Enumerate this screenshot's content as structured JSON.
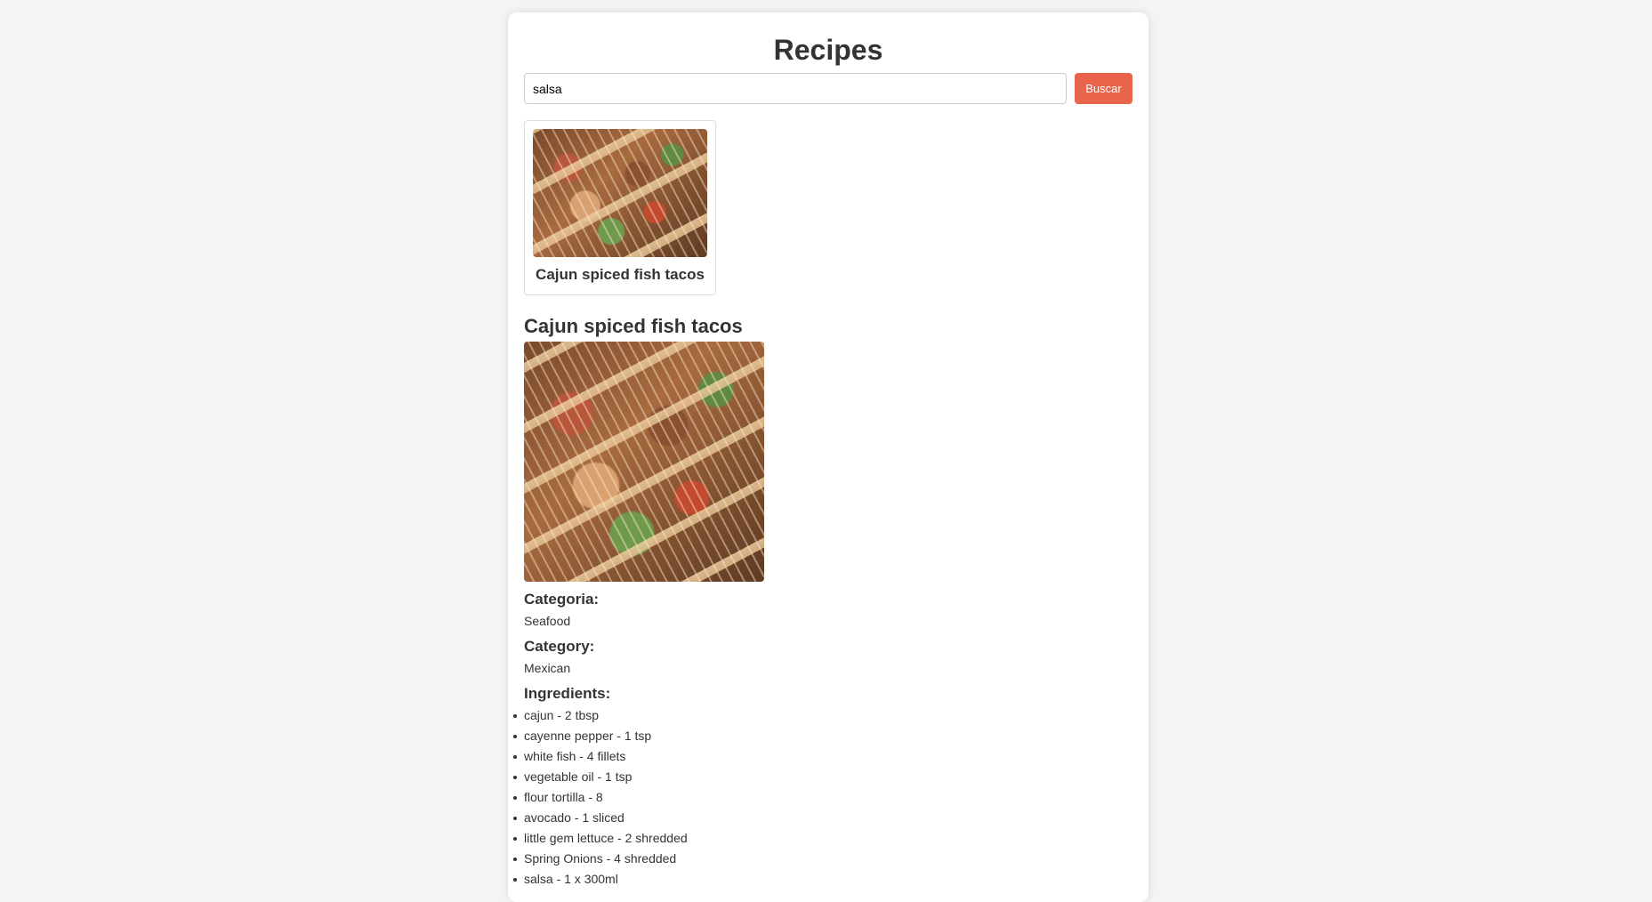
{
  "app": {
    "title": "Recipes"
  },
  "search": {
    "value": "salsa",
    "button_label": "Buscar"
  },
  "results": [
    {
      "name": "Cajun spiced fish tacos",
      "image": "fish-tacos-photo"
    }
  ],
  "detail": {
    "title": "Cajun spiced fish tacos",
    "image": "fish-tacos-photo",
    "labels": {
      "categoria": "Categoria:",
      "category": "Category:",
      "ingredients": "Ingredients:"
    },
    "categoria_value": "Seafood",
    "category_value": "Mexican",
    "ingredients": [
      "cajun - 2 tbsp",
      "cayenne pepper - 1 tsp",
      "white fish - 4 fillets",
      "vegetable oil - 1 tsp",
      "flour tortilla - 8",
      "avocado - 1 sliced",
      "little gem lettuce - 2 shredded",
      "Spring Onions - 4 shredded",
      "salsa - 1 x 300ml"
    ]
  },
  "colors": {
    "background": "#f4f4f4",
    "card": "#ffffff",
    "accent_button": "#e8644a",
    "text": "#333333"
  }
}
